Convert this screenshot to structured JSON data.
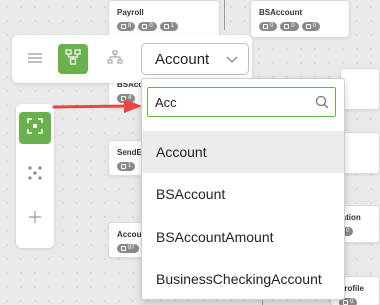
{
  "canvas": {
    "cards": [
      {
        "title": "Payroll",
        "pills": [
          "8",
          "0",
          "1"
        ]
      },
      {
        "title": "BSAccount",
        "pills": [
          "0",
          "0",
          "0"
        ]
      },
      {
        "title": "BSAcct",
        "pills": [
          "4",
          ""
        ]
      },
      {
        "title": "SendEm",
        "pills": [
          "1",
          ""
        ]
      },
      {
        "title": "Accoun",
        "pills": [
          "97",
          ""
        ]
      },
      {
        "title": "ication",
        "pills": [
          "0"
        ]
      },
      {
        "title": "Profile",
        "pills": [
          "0"
        ]
      }
    ]
  },
  "toolbar": {
    "menu_icon": "hamburger-menu-icon",
    "entity_icon": "entity-graph-icon",
    "hierarchy_icon": "hierarchy-icon",
    "select": {
      "value": "Account",
      "chevron": "chevron-down-icon"
    }
  },
  "side_tools": {
    "focus_icon": "focus-frame-icon",
    "scatter_icon": "scatter-dots-icon",
    "add_icon": "plus-icon"
  },
  "dropdown": {
    "search": {
      "value": "Acc",
      "icon": "search-icon"
    },
    "options": [
      "Account",
      "BSAccount",
      "BSAccountAmount",
      "BusinessCheckingAccount"
    ],
    "highlighted_index": 0
  },
  "colors": {
    "accent": "#6ab04c",
    "arrow": "#e84545",
    "pill": "#8a8a8a"
  }
}
